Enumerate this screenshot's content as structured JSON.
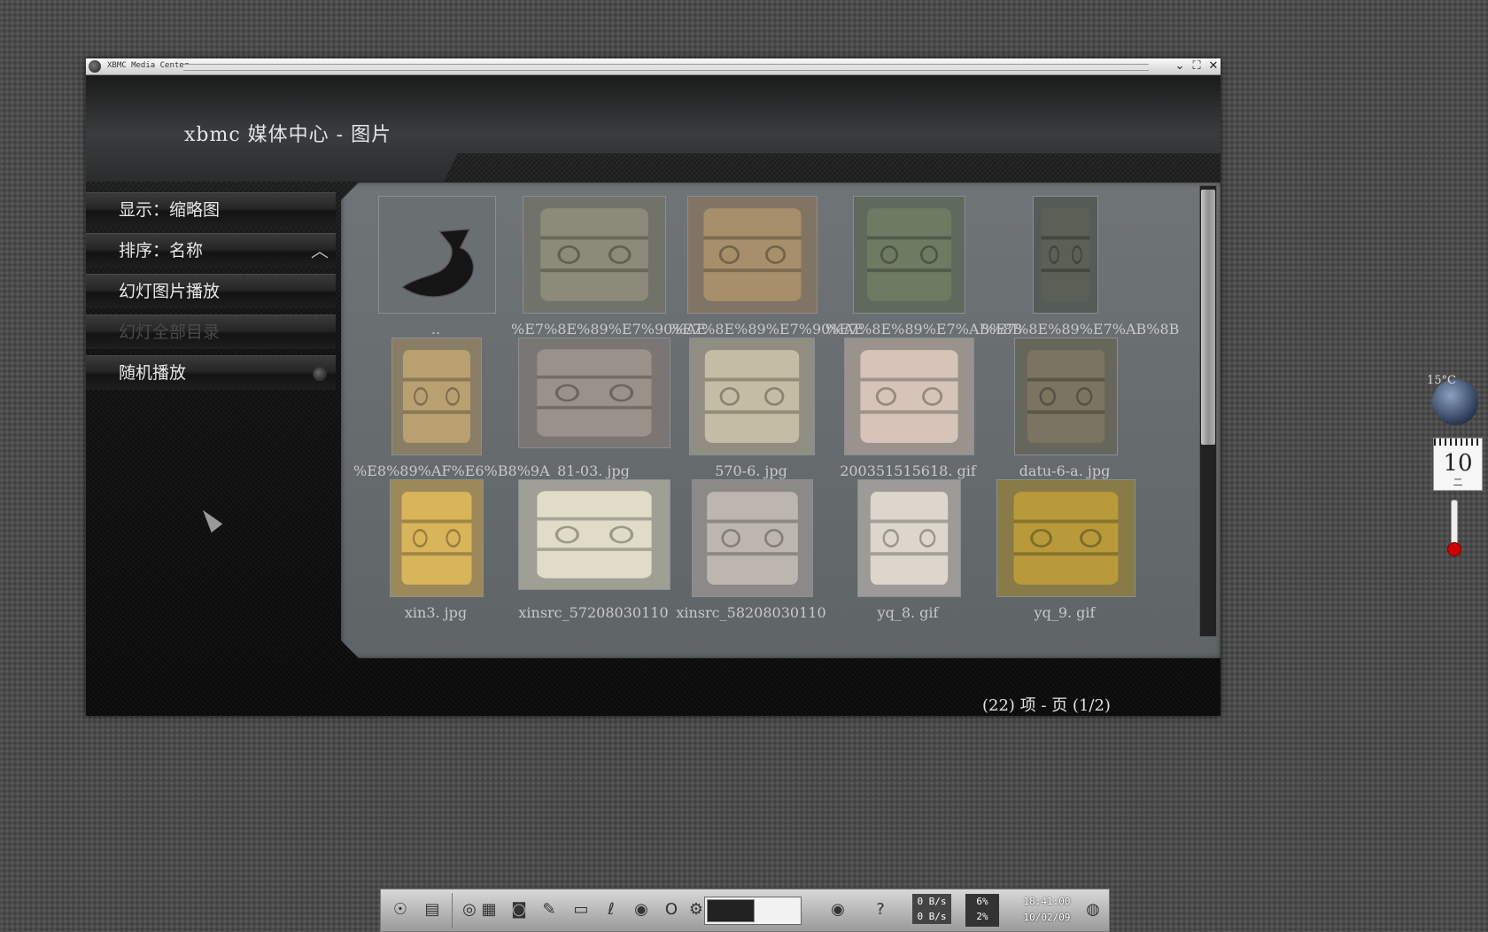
{
  "window": {
    "title": "XBMC Media Center"
  },
  "header": {
    "title": "xbmc 媒体中心 - 图片"
  },
  "sidebar": {
    "items": [
      {
        "label": "显示：缩略图",
        "enabled": true
      },
      {
        "label": "排序：名称",
        "enabled": true,
        "icon": "chevron-up-icon"
      },
      {
        "label": "幻灯图片播放",
        "enabled": true
      },
      {
        "label": "幻灯全部目录",
        "enabled": false
      },
      {
        "label": "随机播放",
        "enabled": true,
        "icon": "radio-icon"
      }
    ]
  },
  "thumbnails": [
    {
      "label": "..",
      "kind": "parent-folder"
    },
    {
      "label": "%E7%8E%89%E7%90%AE",
      "tone": "#8c8a78"
    },
    {
      "label": "%E7%8E%89%E7%90%AE",
      "tone": "#a68f6a"
    },
    {
      "label": "%E7%8E%89%E7%AB%8B",
      "tone": "#6e7a62"
    },
    {
      "label": "%E7%8E%89%E7%AB%8B",
      "tone": "#5a6055"
    },
    {
      "label": "%E8%89%AF%E6%B8%9A",
      "tone": "#b8a070"
    },
    {
      "label": "81-03. jpg",
      "tone": "#9a918a"
    },
    {
      "label": "570-6. jpg",
      "tone": "#c4bca4"
    },
    {
      "label": "200351515618. gif",
      "tone": "#d6c4b8"
    },
    {
      "label": "datu-6-a. jpg",
      "tone": "#7a7460"
    },
    {
      "label": "xin3. jpg",
      "tone": "#d8b45a"
    },
    {
      "label": "xinsrc_57208030110",
      "tone": "#e0dcc8"
    },
    {
      "label": "xinsrc_58208030110",
      "tone": "#bdb6ae"
    },
    {
      "label": "yq_8. gif",
      "tone": "#dcd6cc"
    },
    {
      "label": "yq_9. gif",
      "tone": "#b89a3a"
    }
  ],
  "footer": {
    "page_info": "(22) 项 - 页 (1/2)"
  },
  "desktop": {
    "weather_temp": "15°C",
    "calendar_day": "10",
    "calendar_weekday": "二"
  },
  "taskbar": {
    "clock_time": "18:41:00",
    "clock_date": "10/02/09",
    "net_up": "0 B/s",
    "net_down": "0 B/s",
    "cpu_top": "6%",
    "cpu_bottom": "2%"
  },
  "colors": {
    "accent": "#e4e4e4",
    "panel": "#6b7072",
    "disabled": "#4a4a4a"
  }
}
